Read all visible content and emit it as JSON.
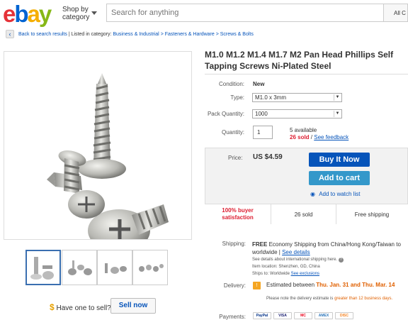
{
  "header": {
    "logo_letters": [
      "e",
      "b",
      "a",
      "y"
    ],
    "logo_colors": [
      "#e53238",
      "#0064d2",
      "#f5af02",
      "#86b817"
    ],
    "shop_by_line1": "Shop by",
    "shop_by_line2": "category",
    "search_placeholder": "Search for anything",
    "all_categories": "All C"
  },
  "breadcrumb": {
    "back_icon": "chevron-left-icon",
    "back_label": "Back to search results",
    "listed_in": "| Listed in category:",
    "crumbs": [
      "Business & Industrial",
      "Fasteners & Hardware",
      "Screws & Bolts"
    ],
    "separator": ">"
  },
  "listing": {
    "title": "M1.0 M1.2 M1.4 M1.7 M2 Pan Head Phillips Self Tapping Screws Ni-Plated Steel",
    "condition_label": "Condition:",
    "condition_value": "New",
    "type_label": "Type:",
    "type_value": "M1.0 x 3mm",
    "pack_label": "Pack Quantity:",
    "pack_value": "1000",
    "quantity_label": "Quantity:",
    "quantity_value": "1",
    "available": "5 available",
    "sold_count": "26 sold",
    "sold_sep": " / ",
    "feedback": "See feedback"
  },
  "buy": {
    "price_label": "Price:",
    "price": "US $4.59",
    "buy_now": "Buy It Now",
    "add_to_cart": "Add to cart",
    "watch": "Add to watch list",
    "stat_buyer_line1": "100% buyer",
    "stat_buyer_line2": "satisfaction",
    "stat_sold": "26 sold",
    "stat_shipping": "Free shipping"
  },
  "shipping": {
    "label": "Shipping:",
    "free": "FREE",
    "line": " Economy Shipping from China/Hong Kong/Taiwan to worldwide | ",
    "see_details": "See details",
    "intl_note": "See details about international shipping here.",
    "location_label": "Item location:",
    "location": "Shenzhen, GD, China",
    "ships_to_label": "Ships to:",
    "ships_to": "Worldwide",
    "exclusions": "See exclusions"
  },
  "delivery": {
    "label": "Delivery:",
    "icon": "!",
    "estimated_prefix": "Estimated between ",
    "date_range": "Thu. Jan. 31 and Thu. Mar. 14",
    "note_prefix": "Please note the delivery estimate is ",
    "note_highlight": "greater than 12 business days."
  },
  "gallery": {
    "thumb_count": 4
  },
  "sell": {
    "dollar": "$",
    "question": "Have one to sell?",
    "button": "Sell now"
  },
  "payments": {
    "label": "Payments:",
    "cards": [
      "PayPal",
      "VISA",
      "MC",
      "AMEX",
      "DISC"
    ]
  }
}
